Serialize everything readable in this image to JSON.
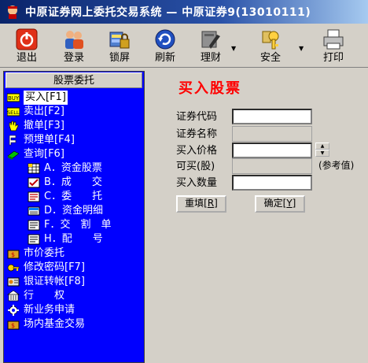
{
  "window": {
    "title": "中原证券网上委托交易系统 — 中原证券9(13010111)"
  },
  "toolbar": {
    "buttons": [
      {
        "label": "退出"
      },
      {
        "label": "登录"
      },
      {
        "label": "锁屏"
      },
      {
        "label": "刷新"
      },
      {
        "label": "理财"
      },
      {
        "label": "安全"
      },
      {
        "label": "打印"
      }
    ]
  },
  "sidebar": {
    "header": "股票委托",
    "items": [
      {
        "label": "买入[F1]",
        "icon": "buy-icon"
      },
      {
        "label": "卖出[F2]",
        "icon": "sell-icon"
      },
      {
        "label": "撤单[F3]",
        "icon": "hand-icon"
      },
      {
        "label": "预埋单[F4]",
        "icon": "preset-order-icon"
      },
      {
        "label": "查询[F6]",
        "icon": "book-icon"
      },
      {
        "label": "A．资金股票",
        "icon": "grid-icon"
      },
      {
        "label": "B．成　　交",
        "icon": "check-icon"
      },
      {
        "label": "C．委　　托",
        "icon": "doc-icon"
      },
      {
        "label": "D．资金明细",
        "icon": "money-icon"
      },
      {
        "label": "F．交　割　单",
        "icon": "doc-icon"
      },
      {
        "label": "H．配　　号",
        "icon": "doc-icon"
      },
      {
        "label": "市价委托",
        "icon": "bag-icon"
      },
      {
        "label": "修改密码[F7]",
        "icon": "key-icon"
      },
      {
        "label": "银证转帐[F8]",
        "icon": "card-icon"
      },
      {
        "label": "行　　权",
        "icon": "building-icon"
      },
      {
        "label": "新业务申请",
        "icon": "gear-icon"
      },
      {
        "label": "场内基金交易",
        "icon": "fund-icon"
      }
    ]
  },
  "form": {
    "title": "买入股票",
    "code_label": "证券代码",
    "name_label": "证券名称",
    "price_label": "买入价格",
    "available_label": "可买(股)",
    "available_hint": "(参考值)",
    "quantity_label": "买入数量",
    "code_value": "",
    "name_value": "",
    "price_value": "",
    "available_value": "",
    "quantity_value": "",
    "reset_label": "重填[",
    "reset_key": "R",
    "reset_close": "]",
    "ok_label": "确定[",
    "ok_key": "Y",
    "ok_close": "]"
  },
  "colors": {
    "sidebar_bg": "#0000ff",
    "title_red": "#ff0000",
    "window_title_bg": "#0a246a"
  }
}
